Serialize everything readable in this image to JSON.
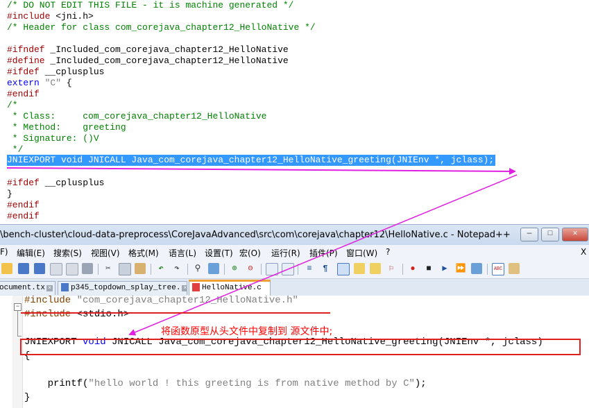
{
  "top_code": {
    "lines": [
      {
        "text": "/* DO NOT EDIT THIS FILE - it is machine generated */",
        "kind": "comment"
      },
      {
        "pre": "#include",
        "rest": " <jni.h>"
      },
      {
        "text": "/* Header for class com_corejava_chapter12_HelloNative */",
        "kind": "comment"
      },
      {
        "pre": "#ifndef",
        "rest": " _Included_com_corejava_chapter12_HelloNative"
      },
      {
        "pre": "#define",
        "rest": " _Included_com_corejava_chapter12_HelloNative"
      },
      {
        "pre": "#ifdef",
        "rest": " __cplusplus"
      },
      {
        "kw": "extern",
        "str": "\"C\"",
        "rest": " {"
      },
      {
        "pre": "#endif"
      },
      {
        "text": "/*",
        "kind": "comment"
      },
      {
        "text": " * Class:     com_corejava_chapter12_HelloNative",
        "kind": "comment"
      },
      {
        "text": " * Method:    greeting",
        "kind": "comment"
      },
      {
        "text": " * Signature: ()V",
        "kind": "comment"
      },
      {
        "text": " */",
        "kind": "comment"
      },
      {
        "text": "JNIEXPORT void JNICALL Java_com_corejava_chapter12_HelloNative_greeting(JNIEnv *, jclass);",
        "kind": "selected"
      },
      {
        "pre": "#ifdef",
        "rest": " __cplusplus"
      },
      {
        "text": "}",
        "kind": "plain"
      },
      {
        "pre": "#endif"
      },
      {
        "pre": "#endif"
      }
    ]
  },
  "window": {
    "title": "\\bench-cluster\\cloud-data-preprocess\\CoreJavaAdvanced\\src\\com\\corejava\\chapter12\\HelloNative.c - Notepad++",
    "minimize": "—",
    "restore": "□",
    "close": "✕",
    "doc_close": "X"
  },
  "menu": [
    "F)",
    "编辑(E)",
    "搜索(S)",
    "视图(V)",
    "格式(M)",
    "语言(L)",
    "设置(T)",
    "宏(O)",
    "运行(R)",
    "插件(P)",
    "窗口(W)",
    "?"
  ],
  "tabs": [
    {
      "label": "ocument.tx"
    },
    {
      "label": "p345_topdown_splay_tree."
    },
    {
      "label": "HelloNative.c"
    }
  ],
  "editor": {
    "line1_pre": "#include",
    "line1_str": "\"com_corejava_chapter12_HelloNative.h\"",
    "line2_pre": "#include",
    "line2_rest": " <stdio.h>",
    "annotation": "将函数原型从头文件中复制到 源文件中;",
    "line3_a": "JNIEXPORT ",
    "line3_kw": "void",
    "line3_b": " JNICALL Java_com_corejava_chapter12_HelloNative_greeting(JNIEnv *, jclass)",
    "line4": "{",
    "line5_fn": "    printf(",
    "line5_str": "\"hello world ! this greeting is from native method by C\"",
    "line5_end": ");",
    "line6": "}"
  },
  "colors": {
    "annotation": "#ff0000",
    "arrow": "#e020e0",
    "underline": "#e020e0",
    "highlight_box": "#e02020"
  }
}
